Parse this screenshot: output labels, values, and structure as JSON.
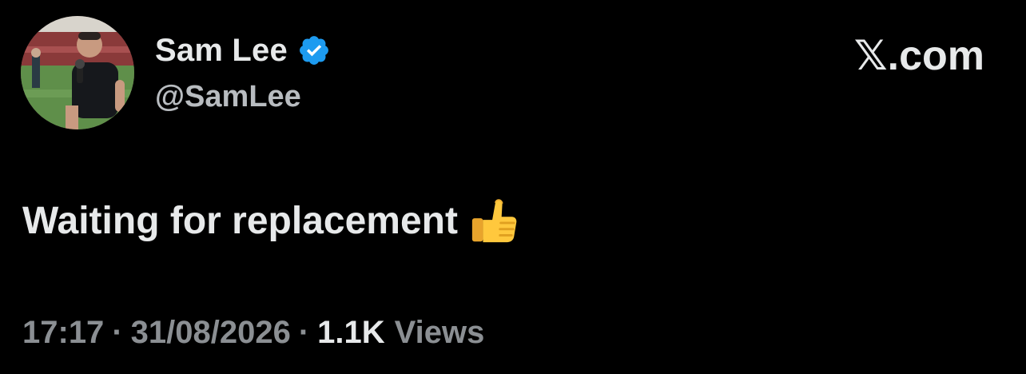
{
  "author": {
    "display_name": "Sam Lee",
    "handle": "@SamLee",
    "verified": true,
    "verified_color": "#1d9bf0"
  },
  "site": {
    "label_x": "𝕏",
    "label_rest": ".com"
  },
  "tweet": {
    "text": "Waiting for replacement",
    "emoji_icon": "thumbs-up-icon"
  },
  "meta": {
    "time": "17:17",
    "separator": "·",
    "date": "31/08/2026",
    "views_count": "1.1K",
    "views_label": "Views"
  },
  "colors": {
    "background": "#000000",
    "primary_text": "#e7e9ea",
    "secondary_text": "#8b8f93"
  }
}
